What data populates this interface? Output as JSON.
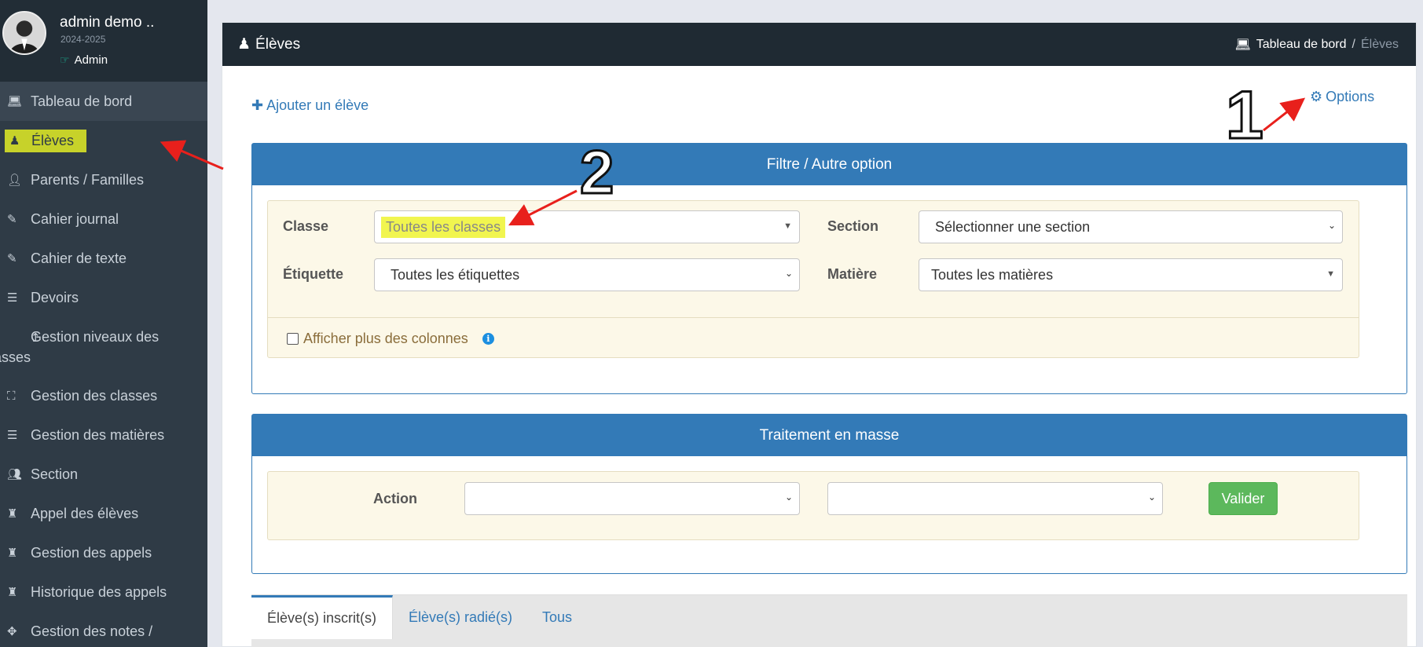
{
  "user": {
    "name": "admin demo ..",
    "year": "2024-2025",
    "role": "Admin"
  },
  "sidebar": {
    "items": [
      {
        "label": "Tableau de bord",
        "icon": "laptop-icon"
      },
      {
        "label": "Élèves",
        "icon": "student-icon"
      },
      {
        "label": "Parents / Familles",
        "icon": "user-icon"
      },
      {
        "label": "Cahier journal",
        "icon": "edit-icon"
      },
      {
        "label": "Cahier de texte",
        "icon": "edit-icon"
      },
      {
        "label": "Devoirs",
        "icon": "stack-icon"
      },
      {
        "label": "Gestion niveaux des classes",
        "icon": "level-up-icon"
      },
      {
        "label": "Gestion des classes",
        "icon": "sitemap-icon"
      },
      {
        "label": "Gestion des matières",
        "icon": "stack-icon"
      },
      {
        "label": "Section",
        "icon": "users-icon"
      },
      {
        "label": "Appel des élèves",
        "icon": "attendance-icon"
      },
      {
        "label": "Gestion des appels",
        "icon": "attendance-icon"
      },
      {
        "label": "Historique des appels",
        "icon": "attendance-icon"
      },
      {
        "label": "Gestion des notes /",
        "icon": "puzzle-icon"
      }
    ]
  },
  "header": {
    "title": "Élèves",
    "breadcrumb_home": "Tableau de bord",
    "breadcrumb_sep": "/",
    "breadcrumb_current": "Élèves"
  },
  "actions": {
    "add_label": "Ajouter un élève",
    "options_label": "Options"
  },
  "filter": {
    "title": "Filtre / Autre option",
    "classe_label": "Classe",
    "classe_value": "Toutes les classes",
    "section_label": "Section",
    "section_value": "Sélectionner une section",
    "etiquette_label": "Étiquette",
    "etiquette_value": "Toutes les étiquettes",
    "matiere_label": "Matière",
    "matiere_value": "Toutes les matières",
    "more_columns_label": "Afficher plus des colonnes"
  },
  "mass": {
    "title": "Traitement en masse",
    "action_label": "Action",
    "action_value_1": "",
    "action_value_2": "",
    "submit_label": "Valider"
  },
  "tabs": [
    {
      "label": "Élève(s) inscrit(s)"
    },
    {
      "label": "Élève(s) radié(s)"
    },
    {
      "label": "Tous"
    }
  ],
  "annotations": {
    "marker_1": "1",
    "marker_2": "2"
  },
  "colors": {
    "sidebar_bg": "#2f3b46",
    "primary": "#337ab7",
    "success": "#5cb85c",
    "highlight": "#c7d22a",
    "annotation_arrow": "#e8201c"
  }
}
